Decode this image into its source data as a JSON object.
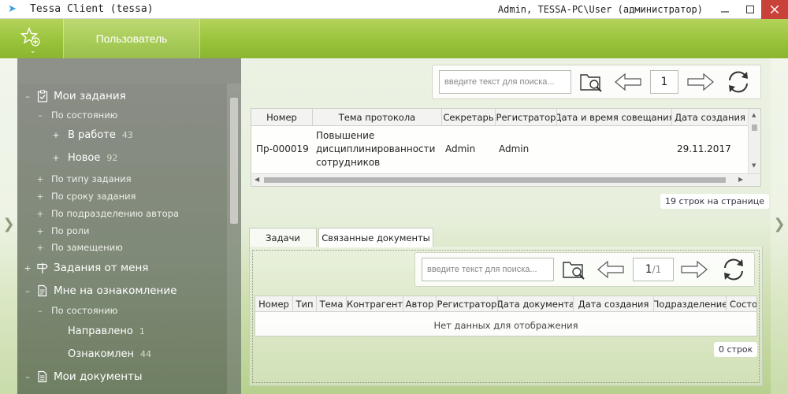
{
  "window": {
    "title": "Tessa Client (tessa)",
    "user": "Admin, TESSA-PC\\User (администратор)"
  },
  "ribbon": {
    "tab_label": "Пользователь"
  },
  "nav": {
    "my_tasks": "Мои задания",
    "by_state": "По состоянию",
    "in_work": "В работе",
    "in_work_count": "43",
    "new": "Новое",
    "new_count": "92",
    "by_type": "По типу задания",
    "by_deadline": "По сроку задания",
    "by_department": "По подразделению автора",
    "by_role": "По роли",
    "by_replacement": "По замещению",
    "tasks_from_me": "Задания от меня",
    "for_review": "Мне на ознакомление",
    "by_state2": "По состоянию",
    "sent": "Направлено",
    "sent_count": "1",
    "reviewed": "Ознакомлен",
    "reviewed_count": "44",
    "my_documents": "Мои документы"
  },
  "top_search": {
    "placeholder": "введите текст для поиска...",
    "page": "1"
  },
  "top_grid": {
    "columns": [
      "Номер",
      "Тема протокола",
      "Секретарь",
      "Регистратор",
      "Дата и время совещания",
      "Дата создания"
    ],
    "row": {
      "number": "Пр-000019",
      "topic_line1": "Повышение",
      "topic_line2": "дисциплинированности",
      "topic_line3": "сотрудников",
      "secretary": "Admin",
      "registrar": "Admin",
      "created": "29.11.2017"
    },
    "rows_per_page": "19 строк на странице"
  },
  "tabs": {
    "tasks": "Задачи",
    "linked_docs": "Связанные документы"
  },
  "bottom_search": {
    "placeholder": "введите текст для поиска...",
    "page_current": "1",
    "page_total": "/1"
  },
  "bottom_grid": {
    "columns": [
      "Номер",
      "Тип",
      "Тема",
      "Контрагент",
      "Автор",
      "Регистратор",
      "Дата документа",
      "Дата создания",
      "Подразделение",
      "Состо"
    ],
    "empty": "Нет данных для отображения",
    "rows_count": "0 строк"
  }
}
